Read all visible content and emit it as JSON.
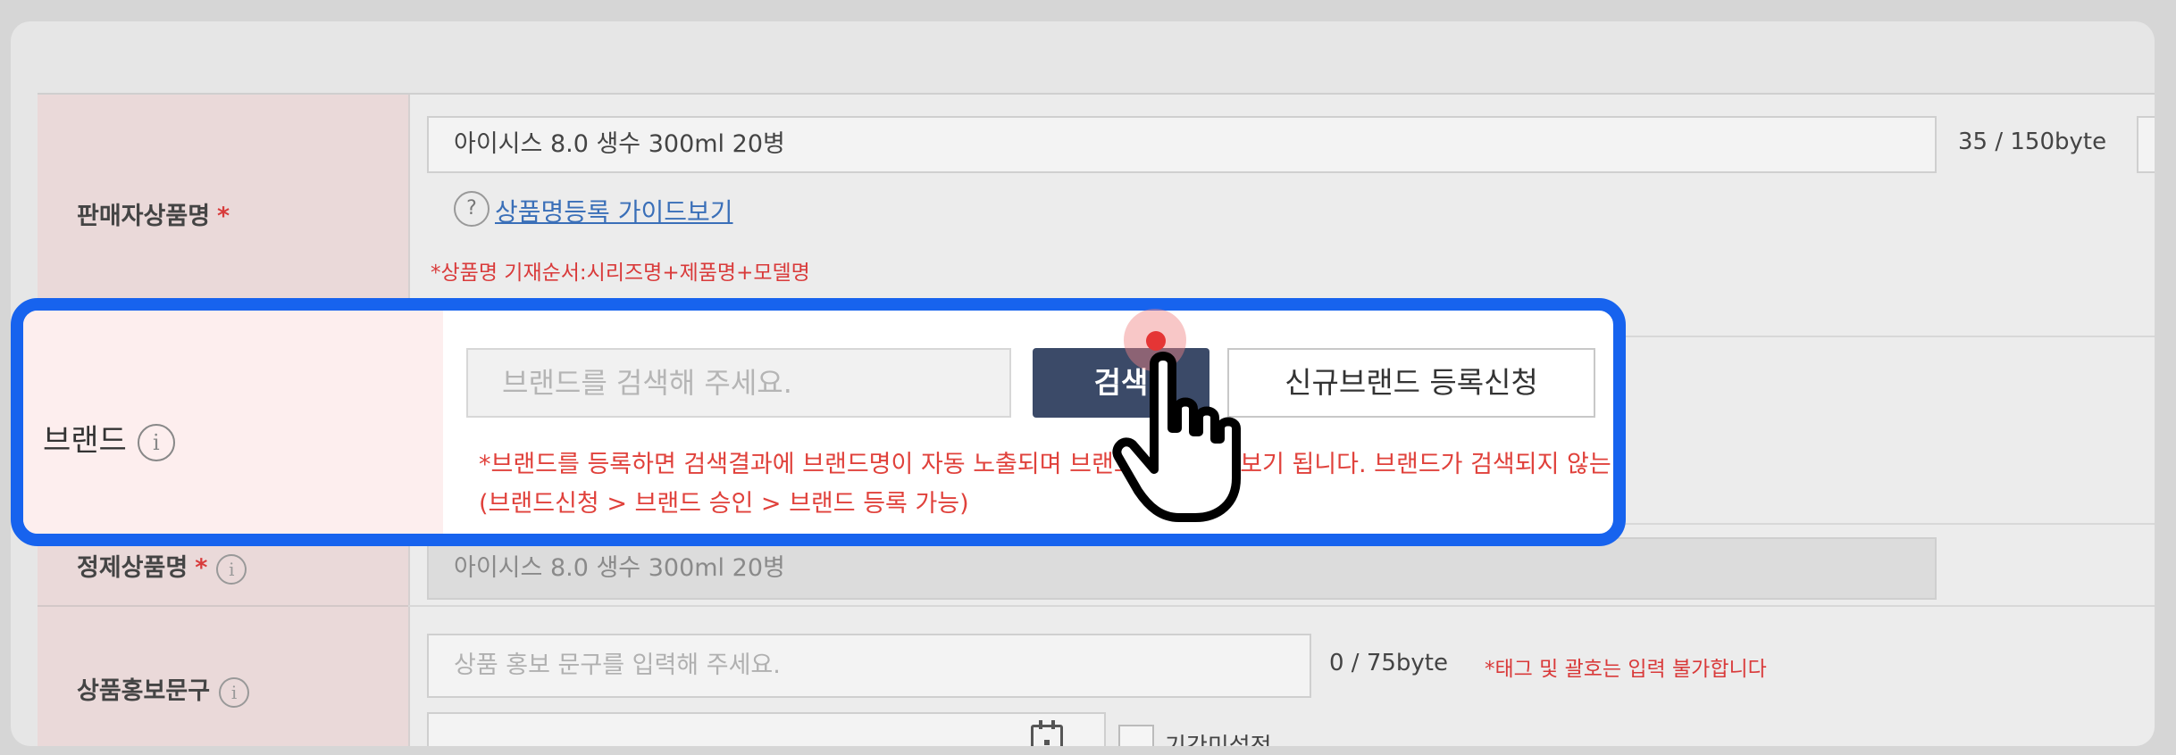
{
  "rows": {
    "seller_product_name": {
      "label": "판매자상품명",
      "required_mark": "*",
      "value": "아이시스 8.0 생수 300ml 20병",
      "byte_count": "35 / 150byte",
      "guide_link": "상품명등록 가이드보기",
      "guide_icon": "?",
      "notice": "*상품명 기재순서:시리즈명+제품명+모델명"
    },
    "brand": {
      "label": "브랜드",
      "info_icon": "i",
      "search_placeholder": "브랜드를 검색해 주세요.",
      "search_button": "검색",
      "new_brand_button": "신규브랜드 등록신청",
      "notice_line1": "*브랜드를 등록하면 검색결과에 브랜드명이 자동 노출되며 브랜드 상품 모아보기 됩니다. 브랜드가 검색되지 않는 경우 신규 브랜드",
      "notice_line2": "(브랜드신청 > 브랜드 승인 > 브랜드 등록 가능)"
    },
    "refined_product_name": {
      "label": "정제상품명",
      "required_mark": "*",
      "info_icon": "i",
      "value": "아이시스 8.0 생수 300ml 20병"
    },
    "promo_text": {
      "label": "상품홍보문구",
      "info_icon": "i",
      "placeholder": "상품 홍보 문구를 입력해 주세요.",
      "byte_count": "0  / 75byte",
      "notice": "*태그 및 괄호는 입력 불가합니다",
      "period_label": "기간미설정"
    }
  },
  "colors": {
    "highlight_border": "#1763ee",
    "search_button_bg": "#3b4a68",
    "warning_text": "#e0413b",
    "click_dot": "#e53535"
  }
}
